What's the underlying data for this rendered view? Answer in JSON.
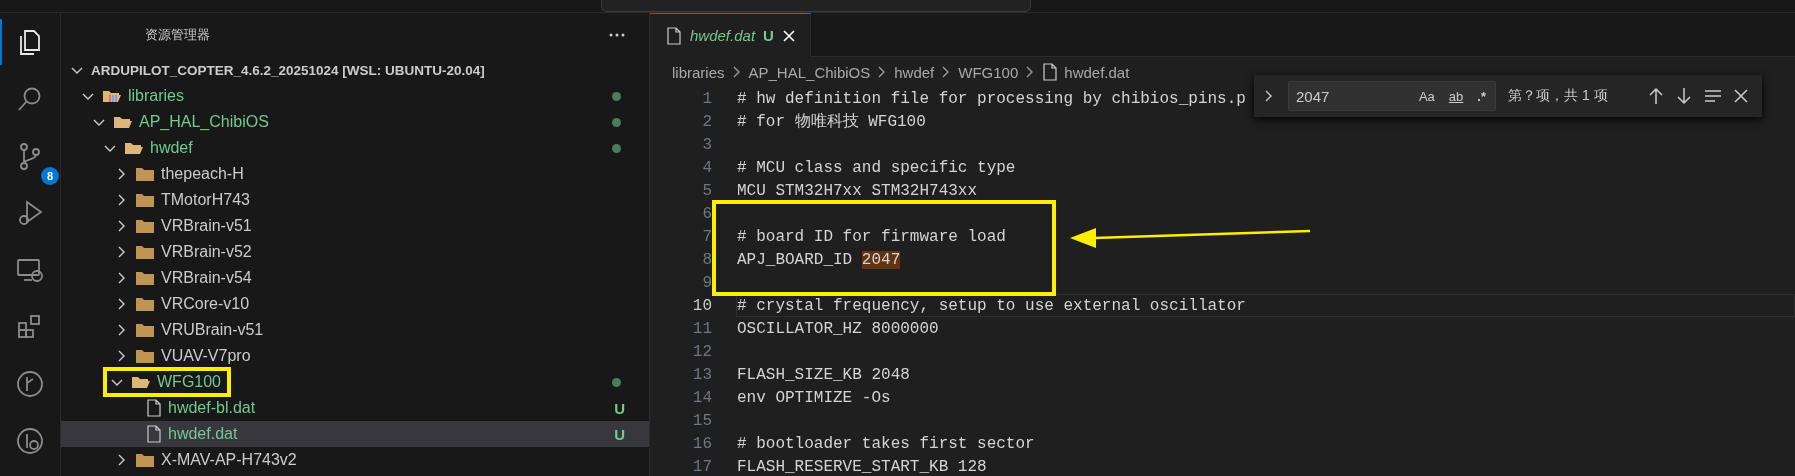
{
  "activity_bar": [
    {
      "kind": "explorer",
      "selected": true
    },
    {
      "kind": "search",
      "selected": false
    },
    {
      "kind": "source-control",
      "selected": false,
      "badge": "8"
    },
    {
      "kind": "debug",
      "selected": false
    },
    {
      "kind": "remote",
      "selected": false
    },
    {
      "kind": "extensions",
      "selected": false
    },
    {
      "kind": "graph",
      "selected": false
    },
    {
      "kind": "graph-search",
      "selected": false
    }
  ],
  "explorer": {
    "title": "资源管理器",
    "root": {
      "label": "ARDUPILOT_COPTER_4.6.2_20251024 [WSL: UBUNTU-20.04]",
      "kind": "root",
      "expanded": true,
      "children": [
        {
          "label": "libraries",
          "kind": "library",
          "expanded": true,
          "changed": true,
          "children": [
            {
              "label": "AP_HAL_ChibiOS",
              "kind": "folder",
              "expanded": true,
              "changed": true,
              "children": [
                {
                  "label": "hwdef",
                  "kind": "folder",
                  "expanded": true,
                  "changed": true,
                  "children": [
                    {
                      "label": "thepeach-H",
                      "kind": "folder",
                      "expanded": false
                    },
                    {
                      "label": "TMotorH743",
                      "kind": "folder",
                      "expanded": false
                    },
                    {
                      "label": "VRBrain-v51",
                      "kind": "folder",
                      "expanded": false
                    },
                    {
                      "label": "VRBrain-v52",
                      "kind": "folder",
                      "expanded": false
                    },
                    {
                      "label": "VRBrain-v54",
                      "kind": "folder",
                      "expanded": false
                    },
                    {
                      "label": "VRCore-v10",
                      "kind": "folder",
                      "expanded": false
                    },
                    {
                      "label": "VRUBrain-v51",
                      "kind": "folder",
                      "expanded": false
                    },
                    {
                      "label": "VUAV-V7pro",
                      "kind": "folder",
                      "expanded": false
                    },
                    {
                      "label": "WFG100",
                      "kind": "folder",
                      "expanded": true,
                      "changed": true,
                      "highlighted": true,
                      "children": [
                        {
                          "label": "hwdef-bl.dat",
                          "kind": "file",
                          "changed": true,
                          "badge": "U",
                          "selected": false
                        },
                        {
                          "label": "hwdef.dat",
                          "kind": "file",
                          "changed": true,
                          "badge": "U",
                          "selected": true
                        }
                      ]
                    },
                    {
                      "label": "X-MAV-AP-H743v2",
                      "kind": "folder",
                      "expanded": false
                    }
                  ]
                }
              ]
            }
          ]
        }
      ]
    }
  },
  "editor": {
    "tabs": [
      {
        "label": "hwdef.dat",
        "badge": "U",
        "preview": true,
        "selected": true
      }
    ],
    "breadcrumb": [
      {
        "label": "libraries",
        "kind": "folder"
      },
      {
        "label": "AP_HAL_ChibiOS",
        "kind": "folder"
      },
      {
        "label": "hwdef",
        "kind": "folder"
      },
      {
        "label": "WFG100",
        "kind": "folder"
      },
      {
        "label": "hwdef.dat",
        "kind": "file"
      }
    ],
    "lines": [
      {
        "num": "1",
        "text": "# hw definition file for processing by chibios_pins.p"
      },
      {
        "num": "2",
        "text": "# for 物唯科技 WFG100"
      },
      {
        "num": "3"
      },
      {
        "num": "4",
        "text": "# MCU class and specific type"
      },
      {
        "num": "5",
        "text": "MCU STM32H7xx STM32H743xx"
      },
      {
        "num": "6",
        "boxed": true
      },
      {
        "num": "7",
        "text": "# board ID for firmware load",
        "boxed": true
      },
      {
        "num": "8",
        "text": "APJ_BOARD_ID ",
        "match": "2047",
        "boxed": true
      },
      {
        "num": "9",
        "boxed": true
      },
      {
        "num": "10",
        "text": "# crystal frequency, setup to use external oscillator",
        "current": true
      },
      {
        "num": "11",
        "text": "OSCILLATOR_HZ 8000000"
      },
      {
        "num": "12"
      },
      {
        "num": "13",
        "text": "FLASH_SIZE_KB 2048"
      },
      {
        "num": "14",
        "text": "env OPTIMIZE -Os"
      },
      {
        "num": "15"
      },
      {
        "num": "16",
        "text": "# bootloader takes first sector"
      },
      {
        "num": "17",
        "text": "FLASH_RESERVE_START_KB 128"
      }
    ],
    "find": {
      "replace_expanded": false,
      "query": "2047",
      "options": [
        {
          "label": "Aa",
          "kind": "case",
          "on": false
        },
        {
          "label": "ab",
          "kind": "word",
          "on": false
        },
        {
          "label": ".*",
          "kind": "regex",
          "on": false
        }
      ],
      "count": "第？项，共 1 项"
    }
  }
}
